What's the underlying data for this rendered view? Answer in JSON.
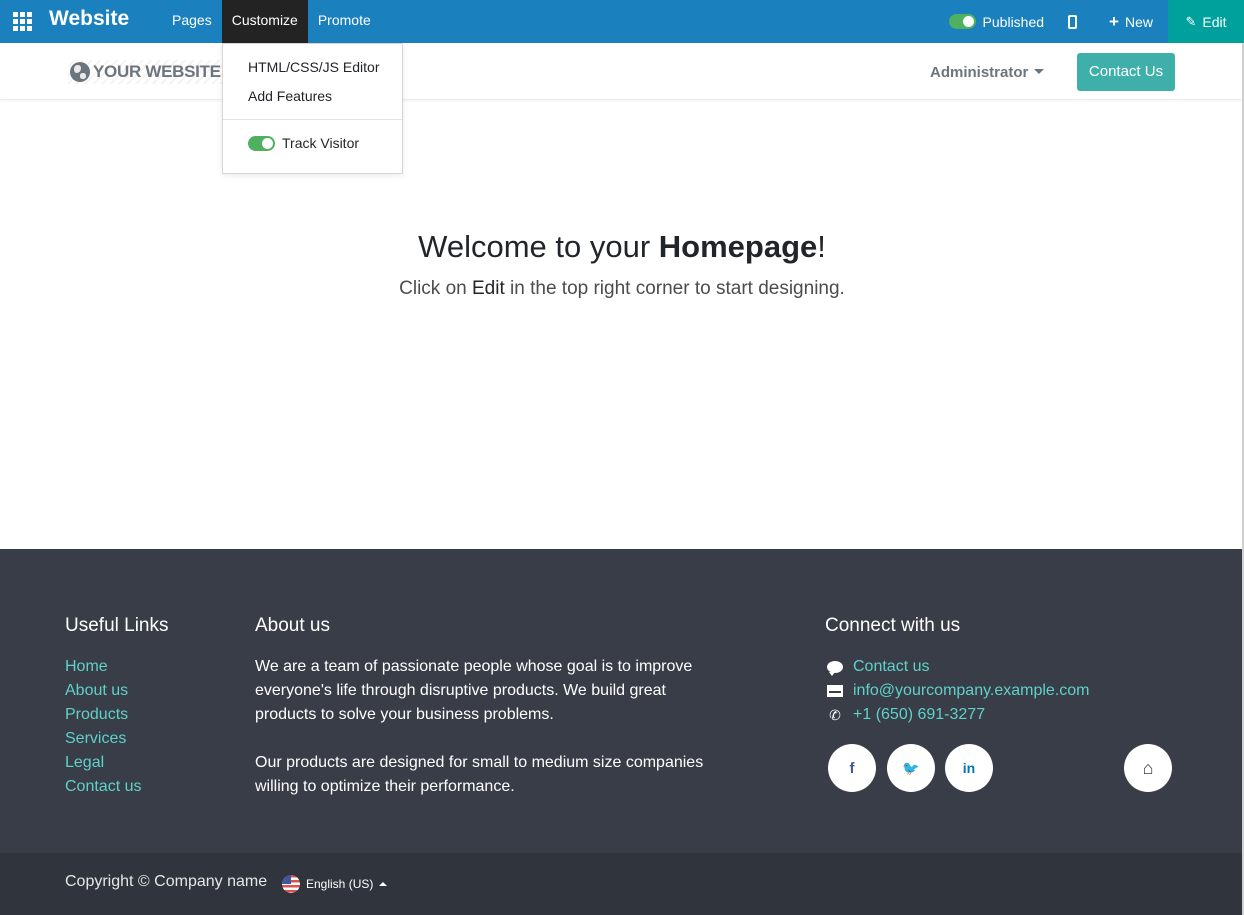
{
  "topbar": {
    "brand": "Website",
    "menu": [
      "Pages",
      "Customize",
      "Promote"
    ],
    "published_label": "Published",
    "new_label": "New",
    "edit_label": "Edit",
    "color": "#1a80be"
  },
  "customize_menu": {
    "items": [
      "HTML/CSS/JS Editor",
      "Add Features"
    ],
    "track_visitor_label": "Track Visitor",
    "track_visitor_on": true
  },
  "header": {
    "logo_text": "YOUR WEBSITE",
    "user_menu": "Administrator",
    "contact_button": "Contact Us"
  },
  "hero": {
    "title_prefix": "Welcome to your ",
    "title_bold": "Homepage",
    "title_suffix": "!",
    "subtitle_prefix": "Click on ",
    "subtitle_bold": "Edit",
    "subtitle_suffix": " in the top right corner to start designing."
  },
  "footer": {
    "useful_links_title": "Useful Links",
    "useful_links": [
      "Home",
      "About us",
      "Products",
      "Services",
      "Legal",
      "Contact us"
    ],
    "about_title": "About us",
    "about_p1": "We are a team of passionate people whose goal is to improve everyone's life through disruptive products. We build great products to solve your business problems.",
    "about_p2": "Our products are designed for small to medium size companies willing to optimize their performance.",
    "connect_title": "Connect with us",
    "contact_link": "Contact us",
    "email": "info@yourcompany.example.com",
    "phone": "+1 (650) 691-3277",
    "social": {
      "facebook": "f",
      "twitter": "🐦",
      "linkedin": "in",
      "home": "⌂"
    },
    "copyright": "Copyright © Company name",
    "language": "English (US)"
  }
}
